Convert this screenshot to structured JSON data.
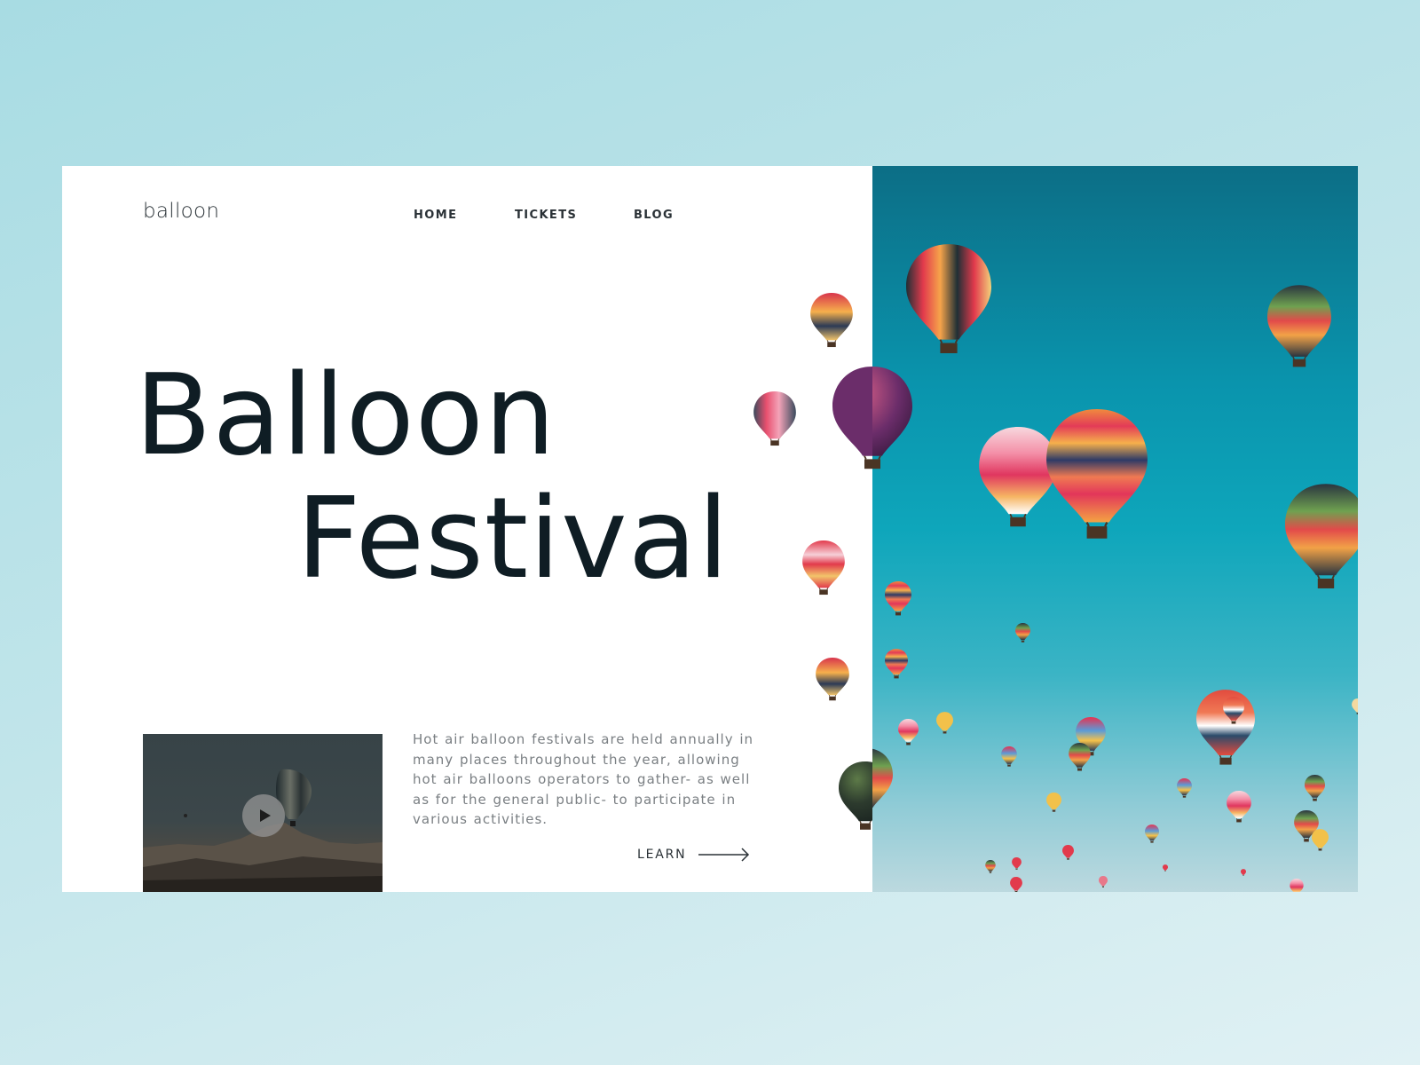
{
  "brand": {
    "logo": "balloon"
  },
  "nav": {
    "home": "HOME",
    "tickets": "TICKETS",
    "blog": "BLOG"
  },
  "hero": {
    "line1": "Balloon",
    "line2": "Festival"
  },
  "description": "Hot air balloon festivals are held annually in many places throughout the year, allowing hot air balloons operators to gather- as well as for the general public- to participate in various activities.",
  "cta": {
    "learn": "LEARN",
    "icon": "arrow-right-icon"
  },
  "video": {
    "icon": "play-icon"
  },
  "colors": {
    "background": "#b8e1e7",
    "card": "#ffffff",
    "text_dark": "#0f1d24",
    "text_muted": "#7a7f83",
    "sky_top": "#0c6e86",
    "sky_mid": "#0ea6bb",
    "sky_bottom": "#bcd9df"
  }
}
